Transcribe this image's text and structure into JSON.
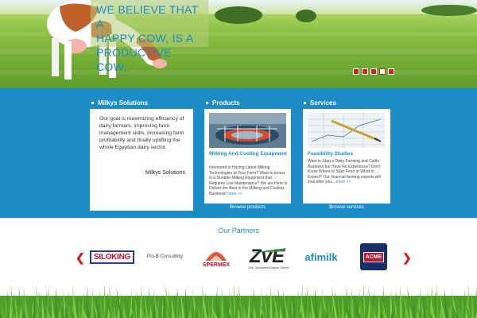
{
  "hero": {
    "tagline_lines": [
      "WE BELIEVE THAT A",
      "HAPPY COW, IS A",
      "PRODUCTIVE COW.."
    ],
    "slider_dots": 5,
    "active_dot": 4
  },
  "about": {
    "title": "Milkys Solutions",
    "text": "Our goal is maximizing efficiency of dairy farmers, improving farm management skills, increasing farm profitability and finally uplifting the whole Egyptian dairy sector.",
    "signature": "Milkys Solutions"
  },
  "products": {
    "title": "Products",
    "card_title": "Milking And Cooling Equipment",
    "card_text": "Interested in Having Latest Milking Technologies at Your Farm? Want to Invest in a Durable Milking Equipment that Requires Low Maintenance? We are Here to Deliver the Best in the Milking and Cooling Business!",
    "more": "more >>",
    "browse": "Browse products"
  },
  "services": {
    "title": "Services",
    "card_title": "Feasibility Studies",
    "card_text": "Want to Start a Dairy Farming and Cattle Business but Have No Experience? Don't Know Where to Start From or What to Expect? Our financial farming experts will look after you...",
    "more": "more >>",
    "browse": "Browse services"
  },
  "partners": {
    "title": "Our Partners",
    "logos": [
      "SILOKING",
      "Pro-B Consulting",
      "SPERMEX",
      "ZvE Zuchtvieh-Export GmbH",
      "afimilk",
      "ACME"
    ]
  },
  "colors": {
    "brand_blue": "#1b8cc6",
    "accent_red": "#cf2020",
    "grass": "#5aa832"
  }
}
